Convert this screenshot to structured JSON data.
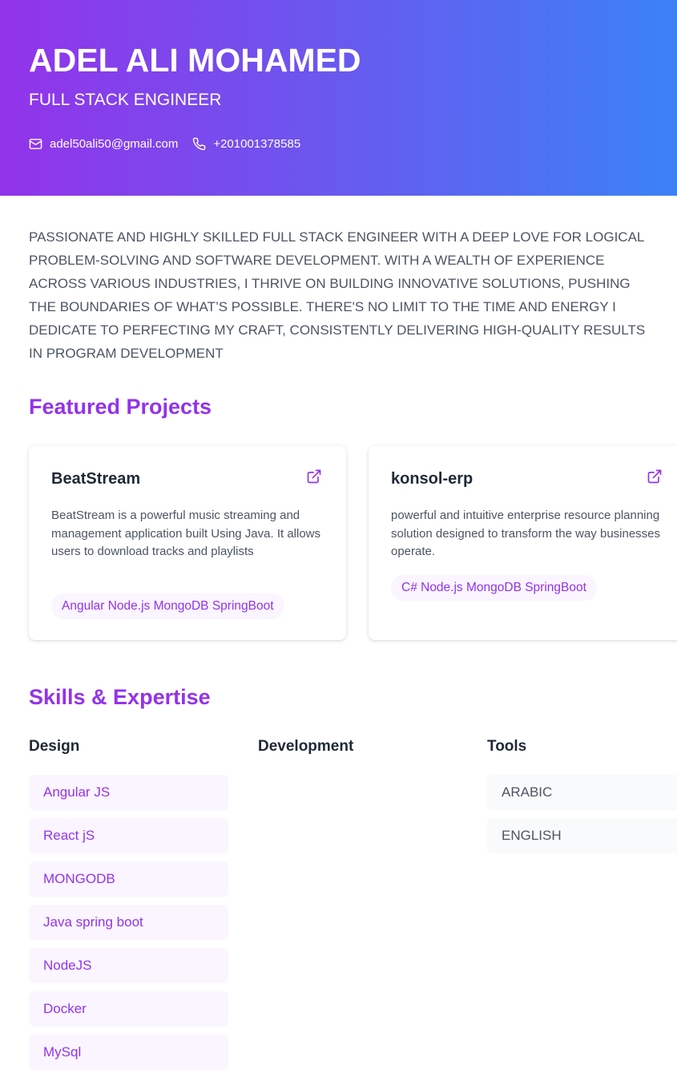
{
  "header": {
    "name": "ADEL ALI MOHAMED",
    "title": "FULL STACK ENGINEER",
    "email": "adel50ali50@gmail.com",
    "phone": "+201001378585",
    "icons": {
      "email": "mail-icon",
      "phone": "phone-icon"
    },
    "gradient": [
      "#9333ea",
      "#3b82f6"
    ]
  },
  "summary": {
    "lines": [
      "PASSIONATE AND HIGHLY SKILLED FULL STACK ENGINEER WITH A DEEP LOVE FOR LOGICAL",
      "PROBLEM-SOLVING AND SOFTWARE DEVELOPMENT. WITH A WEALTH OF EXPERIENCE",
      "ACROSS VARIOUS INDUSTRIES, I THRIVE ON BUILDING INNOVATIVE SOLUTIONS, PUSHING",
      "THE BOUNDARIES OF WHAT’S POSSIBLE. THERE'S NO LIMIT TO THE TIME AND ENERGY I",
      "DEDICATE TO PERFECTING MY CRAFT, CONSISTENTLY DELIVERING HIGH-QUALITY RESULTS",
      "IN PROGRAM DEVELOPMENT"
    ]
  },
  "projects": {
    "title": "Featured Projects",
    "items": [
      {
        "name": "BeatStream",
        "description": "BeatStream is a powerful music streaming and management application built Using Java. It allows users to download tracks and playlists",
        "tags": "Angular Node.js MongoDB SpringBoot",
        "link_icon": "external-link-icon"
      },
      {
        "name": "konsol-erp",
        "description": "powerful and intuitive enterprise resource planning solution designed to transform the way businesses operate.",
        "tags": "C# Node.js MongoDB SpringBoot",
        "link_icon": "external-link-icon"
      }
    ]
  },
  "skills": {
    "title": "Skills & Expertise",
    "columns": [
      {
        "heading": "Design",
        "items": [
          "Angular JS",
          "React jS",
          "MONGODB",
          "Java spring boot",
          "NodeJS",
          "Docker",
          "MySql"
        ]
      },
      {
        "heading": "Development",
        "items": []
      },
      {
        "heading": "Tools",
        "items": [
          "ARABIC",
          "ENGLISH"
        ]
      }
    ]
  },
  "colors": {
    "accent": "#9333ea",
    "accent_bg": "#faf5ff",
    "neutral_bg": "#f9fafb",
    "text": "#4b5563"
  }
}
